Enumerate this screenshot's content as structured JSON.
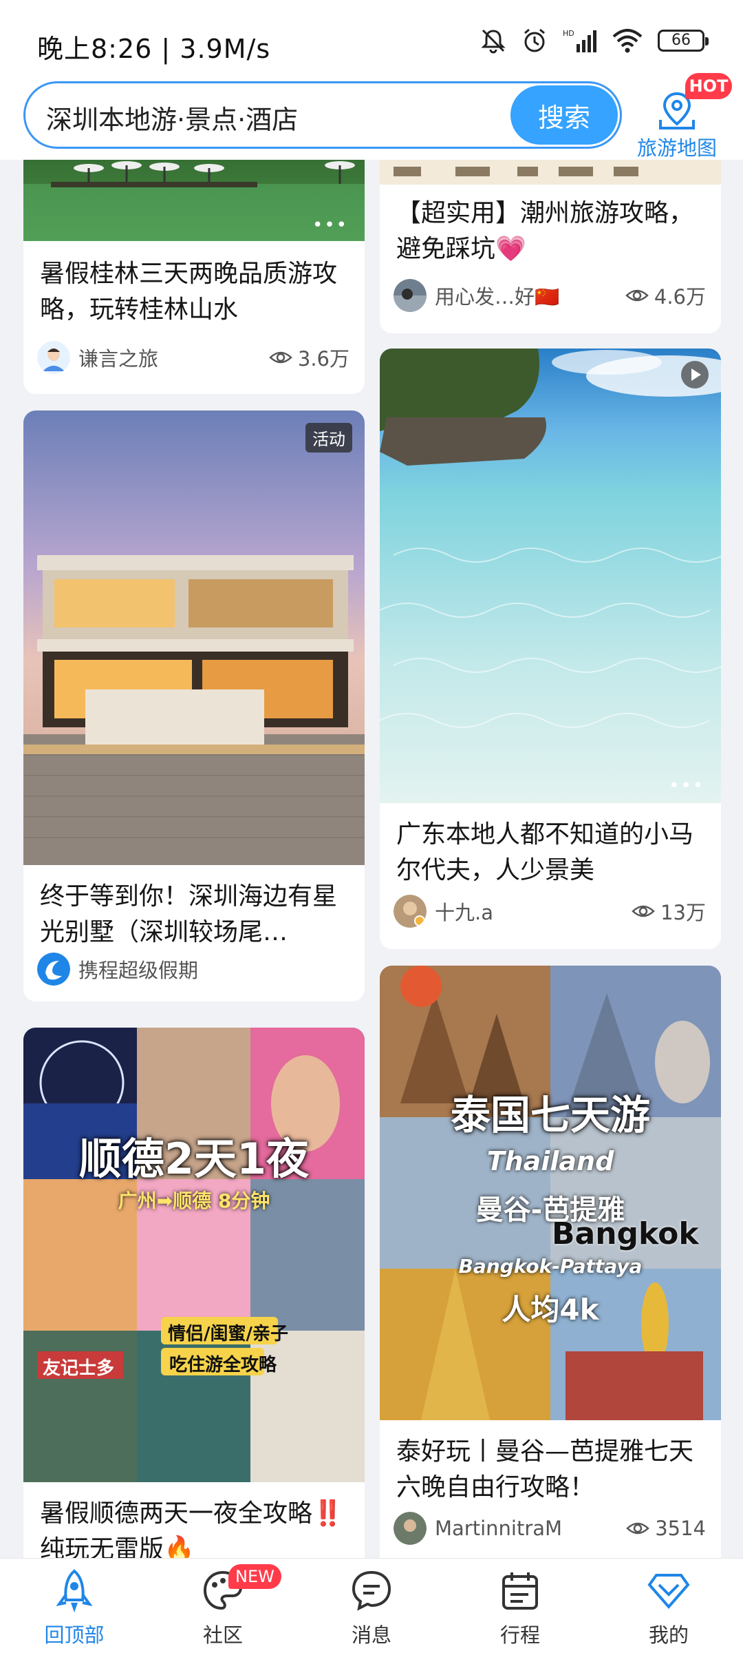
{
  "status_bar": {
    "time": "晚上8:26 | 3.9M/s",
    "battery": "66"
  },
  "header": {
    "search_text": "深圳本地游·景点·酒店",
    "search_button": "搜索",
    "map_label": "旅游地图",
    "map_badge": "HOT"
  },
  "feed": {
    "left": [
      {
        "title": "暑假桂林三天两晚品质游攻略，玩转桂林山水",
        "author": "谦言之旅",
        "views": "3.6万"
      },
      {
        "tag": "活动",
        "title": "终于等到你！深圳海边有星光别墅（深圳较场尾…",
        "author": "携程超级假期"
      },
      {
        "image_headline": "顺德2天1夜",
        "image_sub": "广州➡顺德 8分钟",
        "image_tag1": "情侣/闺蜜/亲子",
        "image_tag2": "吃住游全攻略",
        "image_shop": "友记士多",
        "title": "暑假顺德两天一夜全攻略‼️纯玩无雷版🔥"
      }
    ],
    "right": [
      {
        "title": "【超实用】潮州旅游攻略，避免踩坑💗",
        "author": "用心发…好🇨🇳",
        "views": "4.6万"
      },
      {
        "title": "广东本地人都不知道的小马尔代夫，人少景美",
        "author": "十九.a",
        "views": "13万"
      },
      {
        "image_headline": "泰国七天游",
        "image_en1": "Thailand",
        "image_cn2": "曼谷-芭提雅",
        "image_en2": "Bangkok",
        "image_en3": "Bangkok-Pattaya",
        "image_price": "人均4k",
        "title": "泰好玩丨曼谷—芭提雅七天六晚自由行攻略！",
        "author": "MartinnitraM",
        "views": "3514"
      }
    ]
  },
  "bottom_nav": {
    "items": [
      {
        "label": "回顶部"
      },
      {
        "label": "社区",
        "badge": "NEW"
      },
      {
        "label": "消息"
      },
      {
        "label": "行程"
      },
      {
        "label": "我的"
      }
    ]
  },
  "colors": {
    "accent": "#1f86e8",
    "search_border": "#3a97f4",
    "badge_red": "#ff3b4a"
  }
}
